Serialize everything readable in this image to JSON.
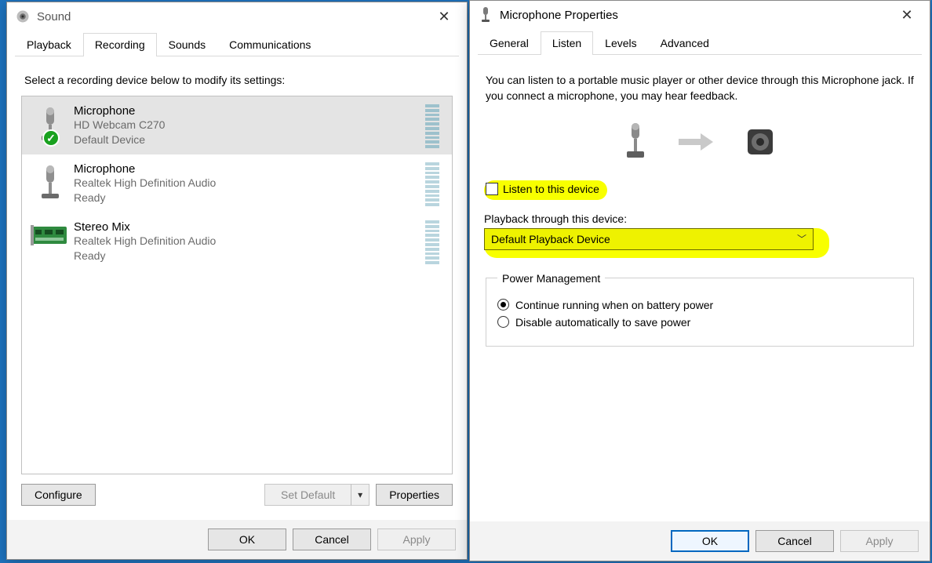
{
  "sound": {
    "title": "Sound",
    "tabs": [
      "Playback",
      "Recording",
      "Sounds",
      "Communications"
    ],
    "activeTab": 1,
    "instruction": "Select a recording device below to modify its settings:",
    "devices": [
      {
        "name": "Microphone",
        "sub1": "HD Webcam C270",
        "sub2": "Default Device",
        "icon": "mic",
        "default": true,
        "selected": true
      },
      {
        "name": "Microphone",
        "sub1": "Realtek High Definition Audio",
        "sub2": "Ready",
        "icon": "mic",
        "default": false,
        "selected": false
      },
      {
        "name": "Stereo Mix",
        "sub1": "Realtek High Definition Audio",
        "sub2": "Ready",
        "icon": "card",
        "default": false,
        "selected": false
      }
    ],
    "buttons": {
      "configure": "Configure",
      "setDefault": "Set Default",
      "properties": "Properties"
    },
    "footer": {
      "ok": "OK",
      "cancel": "Cancel",
      "apply": "Apply"
    }
  },
  "props": {
    "title": "Microphone Properties",
    "tabs": [
      "General",
      "Listen",
      "Levels",
      "Advanced"
    ],
    "activeTab": 1,
    "paragraph": "You can listen to a portable music player or other device through this Microphone jack.  If you connect a microphone, you may hear feedback.",
    "listenCheckbox": "Listen to this device",
    "playbackLabel": "Playback through this device:",
    "playbackSelected": "Default Playback Device",
    "power": {
      "legend": "Power Management",
      "opt1": "Continue running when on battery power",
      "opt2": "Disable automatically to save power",
      "selected": 0
    },
    "footer": {
      "ok": "OK",
      "cancel": "Cancel",
      "apply": "Apply"
    }
  }
}
